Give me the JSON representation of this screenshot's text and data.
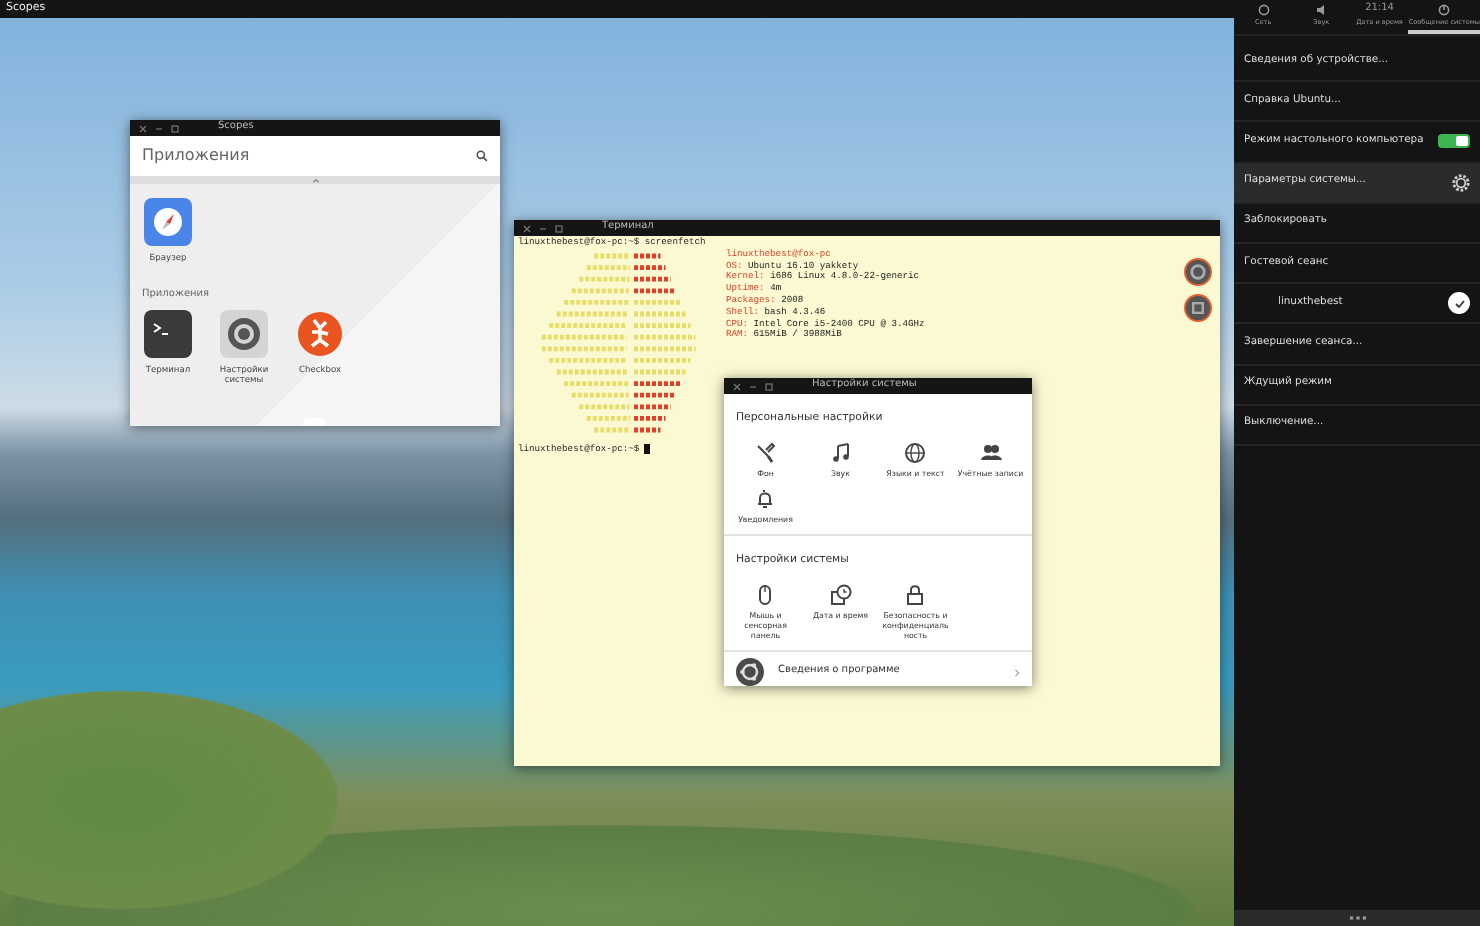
{
  "top_bar": {
    "title": "Scopes"
  },
  "indicators": [
    {
      "kind": "network",
      "label": "Сеть",
      "selected": false
    },
    {
      "kind": "sound",
      "label": "Звук",
      "selected": false
    },
    {
      "kind": "clock",
      "time": "21:14",
      "label": "Дата и время",
      "selected": false
    },
    {
      "kind": "system",
      "label": "Сообщение системы",
      "selected": true
    }
  ],
  "menu": [
    {
      "kind": "item",
      "label": "Сведения об устройстве...",
      "selected": false
    },
    {
      "kind": "item",
      "label": "Справка Ubuntu...",
      "selected": false
    },
    {
      "kind": "toggle",
      "label": "Режим настольного компьютера",
      "on": true,
      "selected": false
    },
    {
      "kind": "settings",
      "label": "Параметры системы...",
      "selected": true
    },
    {
      "kind": "item",
      "label": "Заблокировать",
      "selected": false
    },
    {
      "kind": "item",
      "label": "Гостевой сеанс",
      "selected": false
    },
    {
      "kind": "user",
      "label": "linuxthebest",
      "checked": true,
      "selected": false
    },
    {
      "kind": "item",
      "label": "Завершение сеанса...",
      "selected": false
    },
    {
      "kind": "item",
      "label": "Ждущий режим",
      "selected": false
    },
    {
      "kind": "item",
      "label": "Выключение...",
      "selected": false
    }
  ],
  "scopes_window": {
    "title": "Scopes",
    "header": "Приложения",
    "featured": [
      {
        "kind": "browser",
        "label": "Браузер"
      }
    ],
    "section": "Приложения",
    "apps": [
      {
        "kind": "terminal",
        "label": "Терминал"
      },
      {
        "kind": "settings",
        "label": "Настройки системы"
      },
      {
        "kind": "checkbox",
        "label": "Checkbox"
      }
    ]
  },
  "terminal_window": {
    "title": "Терминал",
    "command_line": "linuxthebest@fox-pc:~$ screenfetch",
    "info": [
      {
        "key": "linuxthebest@fox-pc"
      },
      {
        "key": "OS:",
        "value": "Ubuntu 16.10 yakkety"
      },
      {
        "key": "Kernel:",
        "value": "i686 Linux 4.8.0-22-generic"
      },
      {
        "key": "Uptime:",
        "value": "4m"
      },
      {
        "key": "Packages:",
        "value": "2008"
      },
      {
        "key": "Shell:",
        "value": "bash 4.3.46"
      },
      {
        "key": "CPU:",
        "value": "Intel Core i5-2400 CPU @ 3.4GHz"
      },
      {
        "key": "RAM:",
        "value": "615MiB / 3988MiB"
      }
    ],
    "prompt": "linuxthebest@fox-pc:~$"
  },
  "settings_window": {
    "title": "Настройки системы",
    "sections": [
      {
        "title": "Персональные настройки",
        "items": [
          {
            "kind": "appearance",
            "label": "Фон"
          },
          {
            "kind": "sound",
            "label": "Звук"
          },
          {
            "kind": "language",
            "label": "Языки и текст"
          },
          {
            "kind": "accounts",
            "label": "Учётные записи"
          },
          {
            "kind": "notifications",
            "label": "Уведомления"
          }
        ]
      },
      {
        "title": "Настройки системы",
        "items": [
          {
            "kind": "mouse",
            "label": "Мышь и сенсорная панель"
          },
          {
            "kind": "datetime",
            "label": "Дата и время"
          },
          {
            "kind": "security",
            "label": "Безопасность и конфиденциальность"
          }
        ]
      }
    ],
    "about": "Сведения о программе"
  }
}
